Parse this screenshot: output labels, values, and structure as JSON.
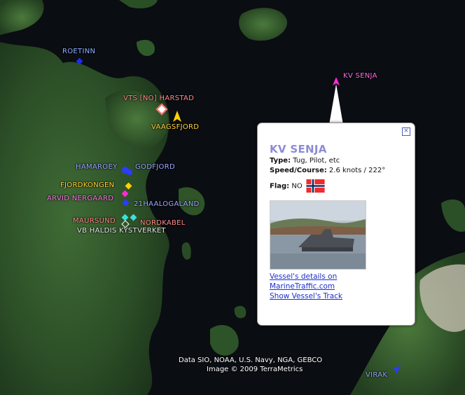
{
  "map": {
    "places": [
      {
        "name": "ROETINN",
        "color": "#8fb0ff",
        "marker": "#1a2cff"
      },
      {
        "name": "VTS [NO] HARSTAD",
        "color": "#ff8a8a",
        "marker": "#ff6a6a"
      },
      {
        "name": "VAAGSFJORD",
        "color": "#ffd23c",
        "marker": "#ffd200"
      },
      {
        "name": "KV SENJA",
        "color": "#ff6ae0",
        "marker": "#ff2ad6"
      },
      {
        "name": "HAMAROEY",
        "color": "#9aa8ff",
        "marker": "#2a3cff"
      },
      {
        "name": "GODFJORD",
        "color": "#9aa8ff",
        "marker": "#2a3cff"
      },
      {
        "name": "FJORDKONGEN",
        "color": "#ffd23c",
        "marker": "#ffd200"
      },
      {
        "name": "ARVID NERGAARD",
        "color": "#ff7ae8",
        "marker": "#ff2ad6"
      },
      {
        "name": "21HAALOGALAND",
        "color": "#9aa8ff",
        "marker": "#2a3cff"
      },
      {
        "name": "MAURSUND",
        "color": "#ff8a8a",
        "marker": "#39e0e0"
      },
      {
        "name": "NORDKABEL",
        "color": "#ff8a8a",
        "marker": "#39e0e0"
      },
      {
        "name": "VB HALDIS KYSTVERKET",
        "color": "#e8e8e8",
        "marker": "#ffffff"
      },
      {
        "name": "VIRAK",
        "color": "#9aa8ff",
        "marker": "#2a3cff"
      }
    ],
    "credits": {
      "data": "Data SIO, NOAA, U.S. Navy, NGA, GEBCO",
      "image": "Image © 2009 TerraMetrics"
    }
  },
  "popup": {
    "title": "KV SENJA",
    "type_label": "Type:",
    "type_value": "Tug, Pilot, etc",
    "speed_label": "Speed/Course:",
    "speed_value": "2.6 knots / 222°",
    "flag_label": "Flag:",
    "flag_value": "NO",
    "close_symbol": "×",
    "links": [
      "Vessel's details on",
      "MarineTraffic.com",
      "Show Vessel's Track"
    ]
  }
}
